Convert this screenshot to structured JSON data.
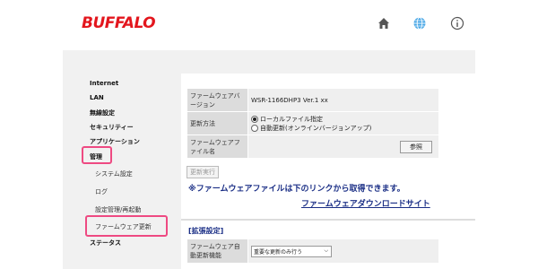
{
  "header": {
    "logo": "BUFFALO",
    "icons": [
      "home-icon",
      "globe-icon",
      "info-icon"
    ]
  },
  "sidebar": {
    "items": [
      {
        "label": "Internet"
      },
      {
        "label": "LAN"
      },
      {
        "label": "無線設定"
      },
      {
        "label": "セキュリティー"
      },
      {
        "label": "アプリケーション"
      },
      {
        "label": "管理"
      },
      {
        "label": "ステータス"
      }
    ],
    "subitems": [
      {
        "label": "システム設定"
      },
      {
        "label": "ログ"
      },
      {
        "label": "設定管理/再起動"
      },
      {
        "label": "ファームウェア更新"
      }
    ]
  },
  "firmware": {
    "version_label": "ファームウェアバージョン",
    "version_value": "WSR-1166DHP3 Ver.1 xx",
    "method_label": "更新方法",
    "method_options": [
      "ローカルファイル指定",
      "自動更新(オンラインバージョンアップ)"
    ],
    "method_selected": 0,
    "file_label": "ファームウェアファイル名",
    "browse_button": "参照",
    "execute_button": "更新実行",
    "notice": "※ファームウェアファイルは下のリンクから取得できます。",
    "download_link": "ファームウェアダウンロードサイト"
  },
  "extended": {
    "heading": "[拡張設定]",
    "auto_update_label": "ファームウェア自動更新機能",
    "auto_update_value": "重要な更新のみ行う"
  },
  "colors": {
    "brand": "#e3161d",
    "highlight": "#ee4a82",
    "link": "#1b2f86"
  }
}
